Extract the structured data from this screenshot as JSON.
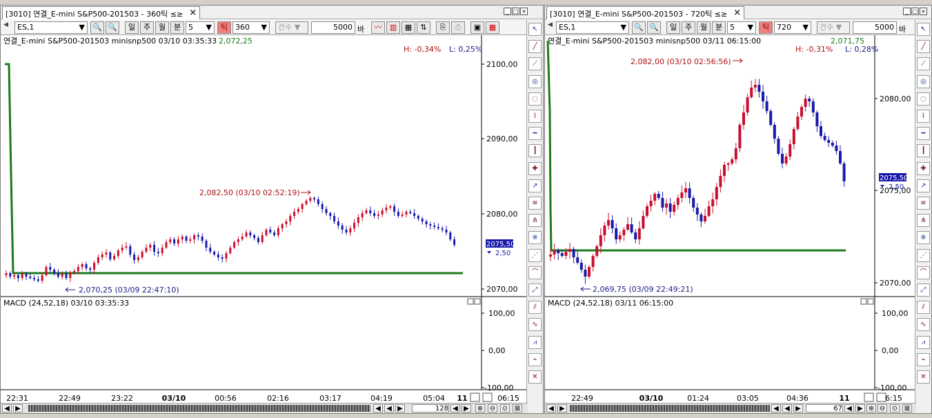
{
  "left": {
    "tab_title": "[3010] 연결_E-mini S&P500-201503 - 360틱",
    "tab_icon": "≤≥",
    "symbol": "ES,1",
    "btn_day": "일",
    "btn_week": "주",
    "btn_month": "월",
    "btn_minute": "분",
    "interval": "5",
    "btn_tick": "틱",
    "tick_value": "360",
    "count_label": "건수",
    "count_value": "5000",
    "bar_label": "바",
    "info": "연결_E-mini S&P500-201503 minisnp500  03/10 03:35:33",
    "info_price": "2,072,25",
    "high_pct": "H: -0,34%",
    "low_pct": "L: 0,25%",
    "price_ticks": [
      "2100,00",
      "2090,00",
      "2080,00",
      "2070,00"
    ],
    "high_annotation": "2,082,50 (03/10 02:52:19)",
    "low_annotation": "2,070,25 (03/09 22:47:10)",
    "last_price": "2075,50",
    "last_change": "2,50",
    "macd_label": "MACD  (24,52,18) 03/10 03:35:33",
    "macd_ticks": [
      "100,00",
      "0,00",
      "-100,00"
    ],
    "time_labels": [
      "22:31",
      "22:49",
      "23:22",
      "03/10",
      "00:56",
      "02:16",
      "03:17",
      "04:19",
      "05:04",
      "11",
      "06:15"
    ],
    "scroll_count": "128"
  },
  "right": {
    "tab_title": "[3010] 연결_E-mini S&P500-201503 - 720틱",
    "tab_icon": "≤≥",
    "symbol": "ES,1",
    "btn_day": "일",
    "btn_week": "주",
    "btn_month": "월",
    "btn_minute": "분",
    "interval": "5",
    "btn_tick": "틱",
    "tick_value": "720",
    "count_label": "건수",
    "count_value": "5000",
    "bar_label": "바",
    "info": "연결_E-mini S&P500-201503 minisnp500  03/11 06:15:00",
    "info_price": "2,071,75",
    "high_pct": "H: -0,31%",
    "low_pct": "L: 0,28%",
    "price_ticks": [
      "2080,00",
      "2075,00",
      "2070,00"
    ],
    "high_annotation": "2,082,00 (03/10 02:56:56)",
    "low_annotation": "2,069,75 (03/09 22:49:21)",
    "last_price": "2075,50",
    "last_change": "2,50",
    "macd_label": "MACD  (24,52,18) 03/11 06:15:00",
    "macd_ticks": [
      "100,00",
      "0,00",
      "-100,00"
    ],
    "time_labels": [
      "22:49",
      "03/10",
      "01:24",
      "03:05",
      "04:36",
      "11",
      "06:15"
    ],
    "scroll_count": "67"
  },
  "colors": {
    "up": "#c8102e",
    "down": "#1a1aaa",
    "line": "#1a7a1a",
    "high_text": "#b01010",
    "low_text": "#1a1a8a"
  },
  "side_icons": [
    "cursor-icon",
    "line-icon",
    "ray-icon",
    "fib-icon",
    "cycle-icon",
    "trend-icon",
    "hline-icon",
    "vline-icon",
    "cross-icon",
    "arrow-icon",
    "channel-icon",
    "pitchfork-icon",
    "gann-icon",
    "fan-icon",
    "arc-icon",
    "speed-icon",
    "parallel-icon",
    "wave-icon",
    "zigzag-icon",
    "elliott-icon",
    "delete-icon"
  ]
}
